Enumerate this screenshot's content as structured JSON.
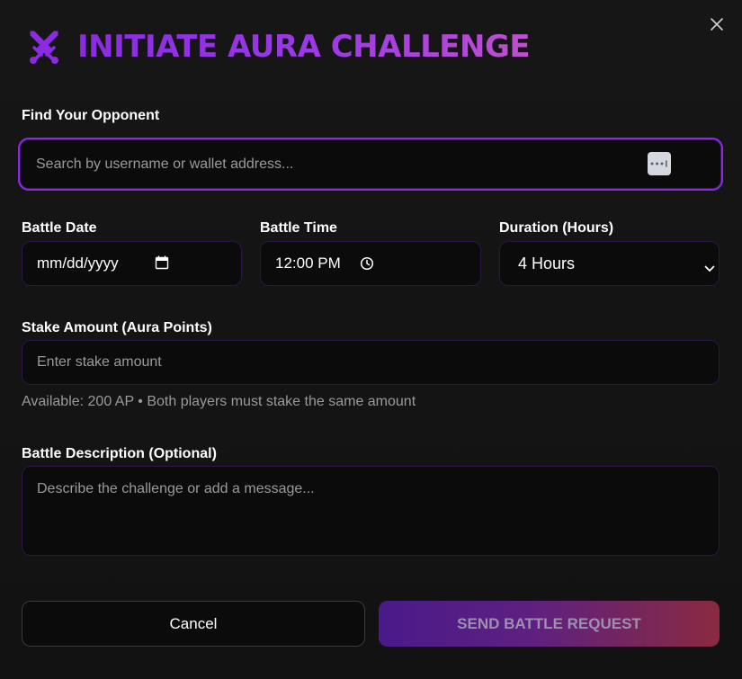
{
  "dialog": {
    "title": "INITIATE AURA CHALLENGE",
    "icon": "crossed-swords-icon",
    "close_icon": "close-icon"
  },
  "opponent": {
    "label": "Find Your Opponent",
    "placeholder": "Search by username or wallet address...",
    "addon_icon": "more-dots-icon"
  },
  "battle_date": {
    "label": "Battle Date",
    "value": "mm/dd/yyyy",
    "icon": "calendar-icon"
  },
  "battle_time": {
    "label": "Battle Time",
    "value": "12:00 PM",
    "icon": "clock-icon"
  },
  "duration": {
    "label": "Duration (Hours)",
    "selected": "4 Hours",
    "icon": "chevron-down-icon"
  },
  "stake": {
    "label": "Stake Amount (Aura Points)",
    "placeholder": "Enter stake amount",
    "hint": "Available: 200 AP • Both players must stake the same amount"
  },
  "description": {
    "label": "Battle Description (Optional)",
    "placeholder": "Describe the challenge or add a message..."
  },
  "actions": {
    "cancel_label": "Cancel",
    "send_label": "SEND BATTLE REQUEST"
  },
  "colors": {
    "accent": "#8a2be2",
    "background": "#121212",
    "field_background": "#0b0b0b"
  }
}
